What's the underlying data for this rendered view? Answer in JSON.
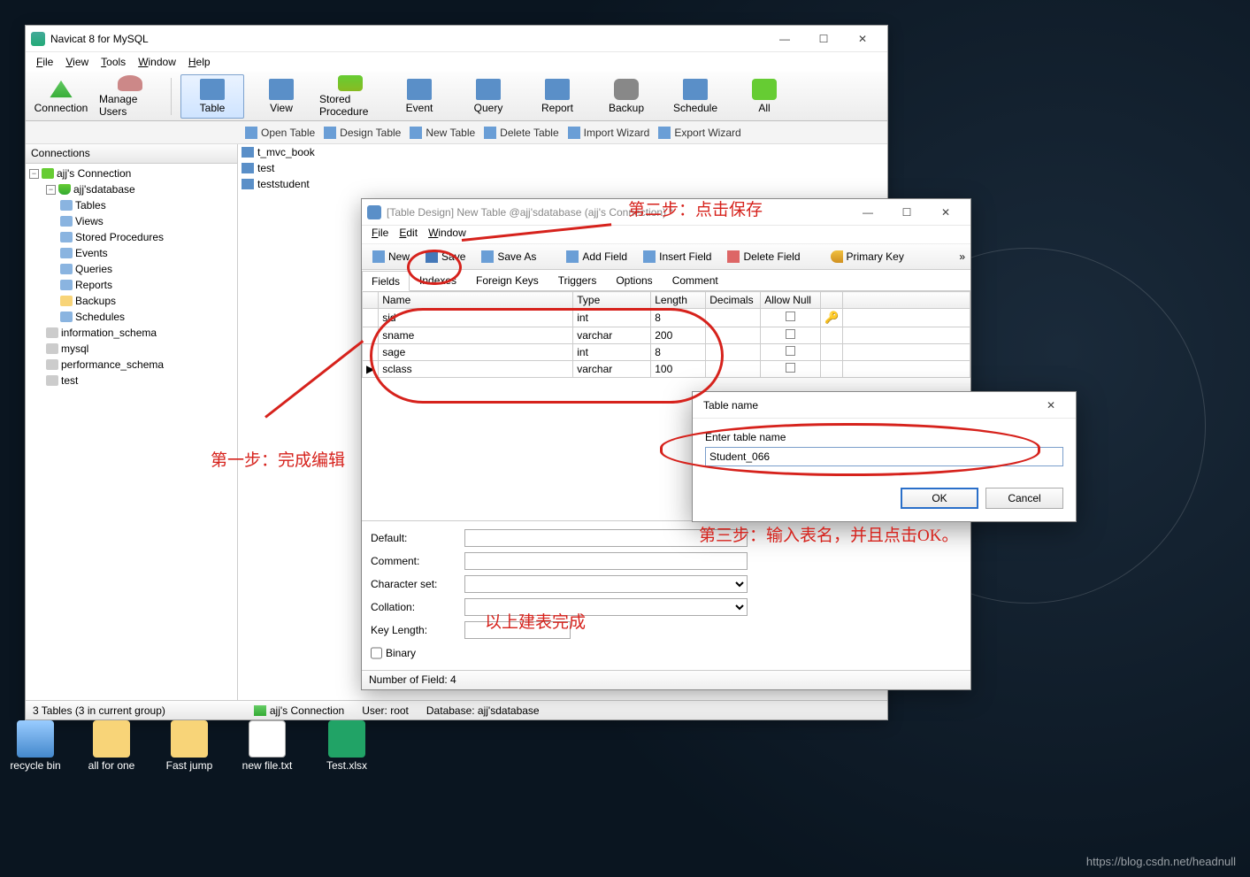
{
  "main": {
    "title": "Navicat 8 for MySQL",
    "menu": {
      "file": "File",
      "view": "View",
      "tools": "Tools",
      "window": "Window",
      "help": "Help"
    },
    "toolbar": {
      "connection": "Connection",
      "manage_users": "Manage Users",
      "table": "Table",
      "view": "View",
      "stored_procedure": "Stored Procedure",
      "event": "Event",
      "query": "Query",
      "report": "Report",
      "backup": "Backup",
      "schedule": "Schedule",
      "all": "All"
    },
    "subtoolbar": {
      "open_table": "Open Table",
      "design_table": "Design Table",
      "new_table": "New Table",
      "delete_table": "Delete Table",
      "import_wizard": "Import Wizard",
      "export_wizard": "Export Wizard"
    },
    "sidebar": {
      "header": "Connections",
      "conn": "ajj's Connection",
      "db": "ajj'sdatabase",
      "nodes": {
        "tables": "Tables",
        "views": "Views",
        "sp": "Stored Procedures",
        "events": "Events",
        "queries": "Queries",
        "reports": "Reports",
        "backups": "Backups",
        "schedules": "Schedules"
      },
      "sysdbs": [
        "information_schema",
        "mysql",
        "performance_schema",
        "test"
      ]
    },
    "content_tables": [
      "t_mvc_book",
      "test",
      "teststudent"
    ],
    "status": {
      "left": "3 Tables (3 in current group)",
      "conn": "ajj's Connection",
      "user": "User: root",
      "db": "Database: ajj'sdatabase"
    }
  },
  "design": {
    "title": "[Table Design] New Table @ajj'sdatabase (ajj's Connection) *",
    "menu": {
      "file": "File",
      "edit": "Edit",
      "window": "Window"
    },
    "toolbar": {
      "new": "New",
      "save": "Save",
      "save_as": "Save As",
      "add_field": "Add Field",
      "insert_field": "Insert Field",
      "delete_field": "Delete Field",
      "primary_key": "Primary Key"
    },
    "tabs": [
      "Fields",
      "Indexes",
      "Foreign Keys",
      "Triggers",
      "Options",
      "Comment"
    ],
    "columns": {
      "name": "Name",
      "type": "Type",
      "length": "Length",
      "decimals": "Decimals",
      "allow_null": "Allow Null"
    },
    "rows": [
      {
        "name": "sid",
        "type": "int",
        "length": "8",
        "decimals": "",
        "pk": true
      },
      {
        "name": "sname",
        "type": "varchar",
        "length": "200",
        "decimals": ""
      },
      {
        "name": "sage",
        "type": "int",
        "length": "8",
        "decimals": ""
      },
      {
        "name": "sclass",
        "type": "varchar",
        "length": "100",
        "decimals": ""
      }
    ],
    "props": {
      "default": "Default:",
      "comment": "Comment:",
      "charset": "Character set:",
      "collation": "Collation:",
      "keylen": "Key Length:",
      "binary": "Binary"
    },
    "status": "Number of Field: 4"
  },
  "dialog": {
    "title": "Table name",
    "label": "Enter table name",
    "value": "Student_066",
    "ok": "OK",
    "cancel": "Cancel"
  },
  "annotations": {
    "step1": "第一步：完成编辑",
    "step2": "第二步：点击保存",
    "step3": "第三步：输入表名，并且点击OK。",
    "done": "以上建表完成"
  },
  "desktop": {
    "recycle": "recycle bin",
    "allforone": "all for one",
    "fastjump": "Fast jump",
    "newfile": "new file.txt",
    "testxlsx": "Test.xlsx"
  },
  "watermark": "https://blog.csdn.net/headnull"
}
